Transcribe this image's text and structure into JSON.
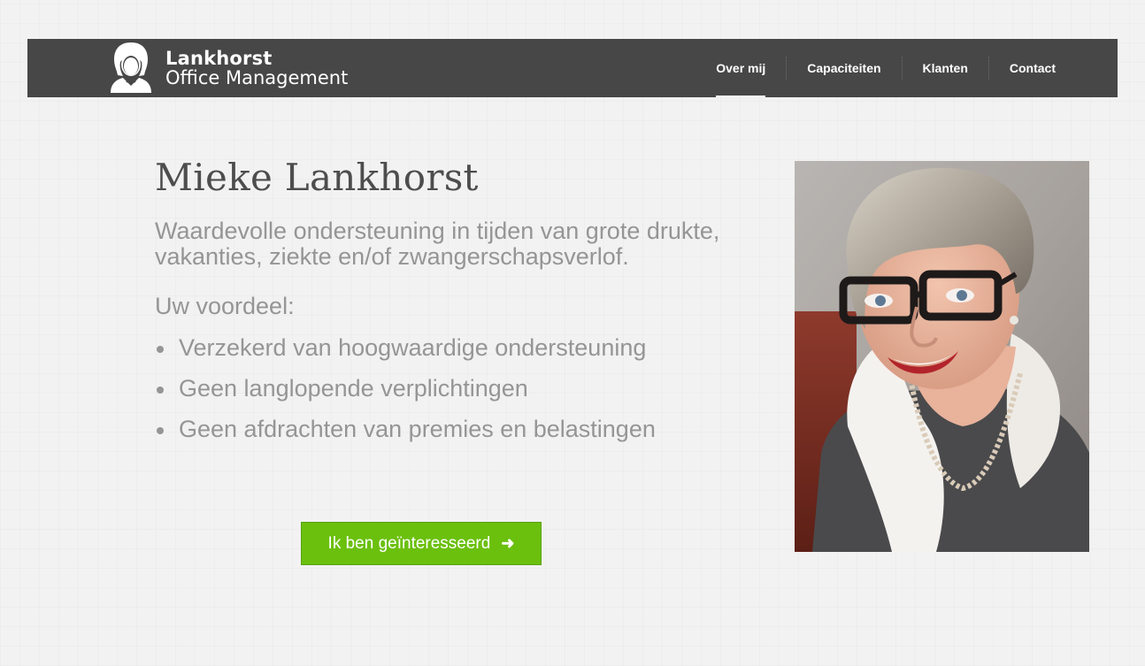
{
  "brand": {
    "name": "Lankhorst",
    "subtitle": "Office Management",
    "logo_icon": "woman-avatar-icon"
  },
  "nav": {
    "items": [
      {
        "label": "Over mij",
        "active": true
      },
      {
        "label": "Capaciteiten",
        "active": false
      },
      {
        "label": "Klanten",
        "active": false
      },
      {
        "label": "Contact",
        "active": false
      }
    ]
  },
  "main": {
    "title": "Mieke Lankhorst",
    "intro": "Waardevolle ondersteuning in tijden van grote drukte, vakanties, ziekte en/of zwangerschapsverlof.",
    "advantage_heading": "Uw voordeel:",
    "benefits": [
      "Verzekerd van hoogwaardige ondersteuning",
      "Geen langlopende verplichtingen",
      "Geen afdrachten van premies en belastingen"
    ],
    "cta_label": "Ik ben geïnteresseerd",
    "cta_icon": "arrow-right-icon"
  },
  "colors": {
    "navbar_bg": "#474747",
    "cta_green": "#6bc00e",
    "text_grey": "#959595",
    "title_grey": "#4d4d4d"
  }
}
